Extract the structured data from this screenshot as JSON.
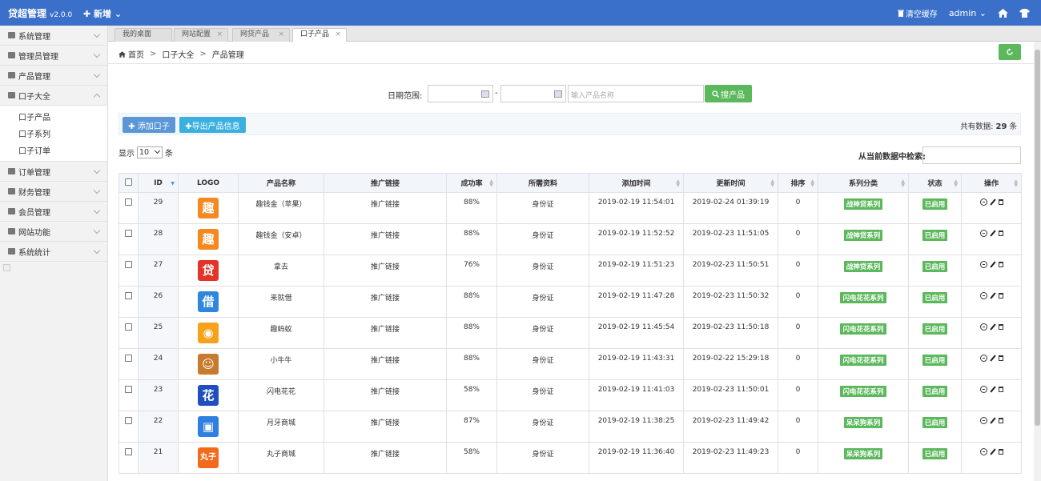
{
  "navbar": {
    "brand": "贷超管理",
    "version": "v2.0.0",
    "new_label": "✚ 新增 ⌄",
    "clear_cache": "清空缓存",
    "admin": "admin ⌄"
  },
  "sidebar": {
    "items": [
      {
        "label": "系统管理"
      },
      {
        "label": "管理员管理"
      },
      {
        "label": "产品管理"
      },
      {
        "label": "口子大全"
      },
      {
        "label": "订单管理"
      },
      {
        "label": "财务管理"
      },
      {
        "label": "会员管理"
      },
      {
        "label": "网站功能"
      },
      {
        "label": "系统统计"
      }
    ],
    "sub_items": [
      {
        "label": "口子产品"
      },
      {
        "label": "口子系列"
      },
      {
        "label": "口子订单"
      }
    ]
  },
  "tabs": [
    {
      "label": "我的桌面"
    },
    {
      "label": "网站配置"
    },
    {
      "label": "网贷产品"
    },
    {
      "label": "口子产品"
    }
  ],
  "breadcrumb": {
    "home": "首页",
    "level1": "口子大全",
    "level2": "产品管理",
    "sep": ">"
  },
  "search": {
    "date_label": "日期范围:",
    "dash": "-",
    "name_placeholder": "输入产品名称",
    "button": "搜产品"
  },
  "toolbar": {
    "add": "✚ 添加口子",
    "export": "✚导出产品信息",
    "total_prefix": "共有数据:",
    "total_count": "29",
    "total_suffix": "条"
  },
  "list_controls": {
    "show": "显示",
    "page_size": "10",
    "unit": "条",
    "filter_label": "从当前数据中检索:"
  },
  "table": {
    "headers": [
      "",
      "ID",
      "LOGO",
      "产品名称",
      "推广链接",
      "成功率",
      "所需资料",
      "添加时间",
      "更新时间",
      "排序",
      "系列分类",
      "状态",
      "操作"
    ],
    "rows": [
      {
        "id": "29",
        "logo": "趣",
        "logo_color": "#f5891f",
        "name": "趣钱金（苹果）",
        "link": "推广链接",
        "rate": "88%",
        "docs": "身份证",
        "added": "2019-02-19 11:54:01",
        "updated": "2019-02-24 01:39:19",
        "sort": "0",
        "series": "战神贷系列",
        "status": "已启用"
      },
      {
        "id": "28",
        "logo": "趣",
        "logo_color": "#f5891f",
        "name": "趣钱金（安卓）",
        "link": "推广链接",
        "rate": "88%",
        "docs": "身份证",
        "added": "2019-02-19 11:52:52",
        "updated": "2019-02-23 11:51:05",
        "sort": "0",
        "series": "战神贷系列",
        "status": "已启用"
      },
      {
        "id": "27",
        "logo": "贷",
        "logo_color": "#e4342a",
        "name": "拿去",
        "link": "推广链接",
        "rate": "76%",
        "docs": "身份证",
        "added": "2019-02-19 11:51:23",
        "updated": "2019-02-23 11:50:51",
        "sort": "0",
        "series": "战神贷系列",
        "status": "已启用"
      },
      {
        "id": "26",
        "logo": "借",
        "logo_color": "#2e86de",
        "name": "来就借",
        "link": "推广链接",
        "rate": "88%",
        "docs": "身份证",
        "added": "2019-02-19 11:47:28",
        "updated": "2019-02-23 11:50:32",
        "sort": "0",
        "series": "闪电花花系列",
        "status": "已启用"
      },
      {
        "id": "25",
        "logo": "◉",
        "logo_color": "#f7a21b",
        "name": "趣蚂蚁",
        "link": "推广链接",
        "rate": "88%",
        "docs": "身份证",
        "added": "2019-02-19 11:45:54",
        "updated": "2019-02-23 11:50:18",
        "sort": "0",
        "series": "闪电花花系列",
        "status": "已启用"
      },
      {
        "id": "24",
        "logo": "☺",
        "logo_color": "#c87a2e",
        "name": "小牛牛",
        "link": "推广链接",
        "rate": "88%",
        "docs": "身份证",
        "added": "2019-02-19 11:43:31",
        "updated": "2019-02-22 15:29:18",
        "sort": "0",
        "series": "闪电花花系列",
        "status": "已启用"
      },
      {
        "id": "23",
        "logo": "花",
        "logo_color": "#1f4fbf",
        "name": "闪电花花",
        "link": "推广链接",
        "rate": "58%",
        "docs": "身份证",
        "added": "2019-02-19 11:41:03",
        "updated": "2019-02-23 11:50:01",
        "sort": "0",
        "series": "闪电花花系列",
        "status": "已启用"
      },
      {
        "id": "22",
        "logo": "▣",
        "logo_color": "#2f7fe0",
        "name": "月牙商城",
        "link": "推广链接",
        "rate": "87%",
        "docs": "身份证",
        "added": "2019-02-19 11:38:25",
        "updated": "2019-02-23 11:49:42",
        "sort": "0",
        "series": "呆呆狗系列",
        "status": "已启用"
      },
      {
        "id": "21",
        "logo": "丸子",
        "logo_color": "#f26b1d",
        "name": "丸子商城",
        "link": "推广链接",
        "rate": "58%",
        "docs": "身份证",
        "added": "2019-02-19 11:36:40",
        "updated": "2019-02-23 11:49:23",
        "sort": "0",
        "series": "呆呆狗系列",
        "status": "已启用"
      }
    ]
  },
  "colors": {
    "navbar": "#3a70c9",
    "green": "#5cb85c",
    "blue": "#5b97d6"
  }
}
